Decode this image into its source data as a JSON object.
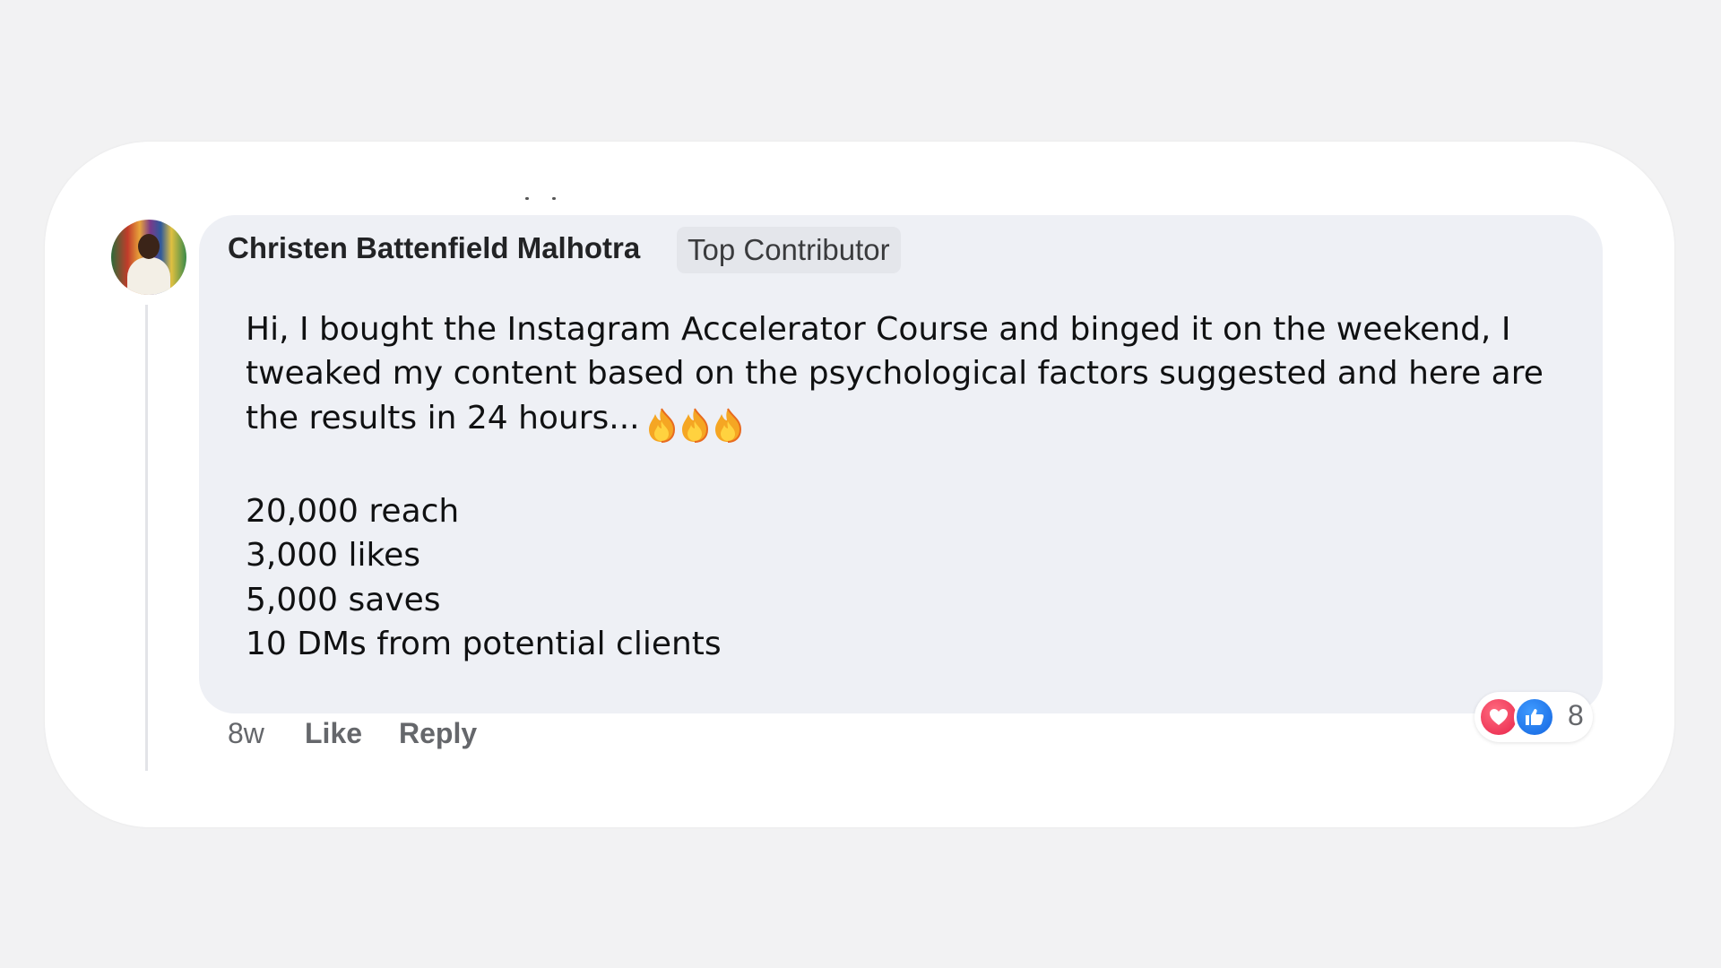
{
  "comment": {
    "author": "Christen Battenfield Malhotra",
    "badge": "Top Contributor",
    "body_lines": [
      "Hi, I bought the Instagram Accelerator Course and binged it on the weekend, I",
      "tweaked my content based on the psychological factors suggested and here are",
      "the results in 24 hours..."
    ],
    "emoji": [
      "fire-icon",
      "fire-icon",
      "fire-icon"
    ],
    "stats": [
      "20,000 reach",
      "3,000 likes",
      "5,000 saves",
      "10 DMs from potential clients"
    ],
    "time_ago": "8w",
    "like_label": "Like",
    "reply_label": "Reply",
    "reactions": {
      "icons": [
        "heart-icon",
        "thumbs-up-icon"
      ],
      "count": "8"
    }
  },
  "colors": {
    "page_background": "#f2f2f3",
    "card": "#ffffff",
    "bubble": "#eef0f5",
    "love": "#e8244a",
    "like": "#1465e0",
    "meta_text": "#65676b"
  }
}
